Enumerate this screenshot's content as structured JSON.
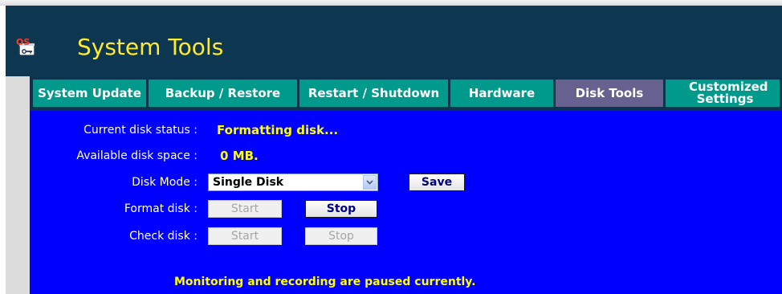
{
  "header": {
    "title": "System Tools",
    "logo_icon": "os-tools-logo-icon",
    "logo_text": "OS"
  },
  "tabs": [
    {
      "label": "System Update",
      "active": false
    },
    {
      "label": "Backup / Restore",
      "active": false
    },
    {
      "label": "Restart / Shutdown",
      "active": false
    },
    {
      "label": "Hardware",
      "active": false
    },
    {
      "label": "Disk Tools",
      "active": true
    },
    {
      "label": "Customized Settings",
      "active": false
    }
  ],
  "disk": {
    "status_label": "Current disk status :",
    "status_value": "Formatting disk...",
    "space_label": "Available disk space :",
    "space_value": "0 MB.",
    "mode_label": "Disk Mode :",
    "mode_selected": "Single Disk",
    "save_label": "Save",
    "format_label": "Format disk :",
    "format_start": "Start",
    "format_stop": "Stop",
    "check_label": "Check disk :",
    "check_start": "Start",
    "check_stop": "Stop"
  },
  "notice": "Monitoring and recording are paused currently.",
  "colors": {
    "header_bg": "#0d3650",
    "title": "#ffea2f",
    "tab": "#009a8d",
    "tab_active": "#67618f",
    "panel": "#0000ff",
    "highlight_text": "#ffff00"
  }
}
